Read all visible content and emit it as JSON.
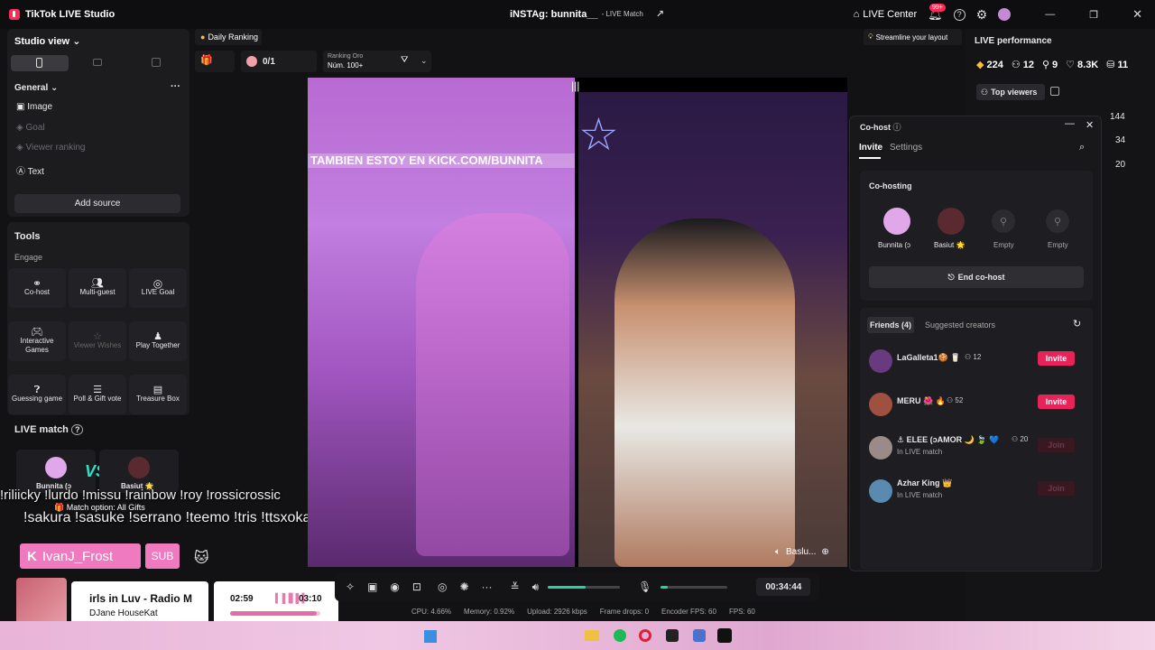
{
  "app": {
    "title": "TikTok LIVE Studio"
  },
  "window": {
    "center_title": "iNSTAg: bunnita__",
    "center_sub": "- LIVE Match",
    "live_center": "LIVE Center",
    "notif_badge": "99+"
  },
  "studio": {
    "view_label": "Studio view",
    "general": "General",
    "sources": [
      "Image",
      "Goal",
      "Viewer ranking",
      "Text"
    ],
    "add_source": "Add source"
  },
  "tools": {
    "heading": "Tools",
    "engage": "Engage",
    "items": [
      "Co-host",
      "Multi-guest",
      "LIVE Goal",
      "Interactive Games",
      "Viewer Wishes",
      "Play Together",
      "Guessing game",
      "Poll & Gift vote",
      "Treasure Box"
    ]
  },
  "live_match": {
    "heading": "LIVE match",
    "p1": "Bunnita (ↄ",
    "p2": "Basiut 🌟",
    "match_option": "Match option: All Gifts"
  },
  "overlay": {
    "line1": "!sakura !sasuke !serrano !teemo !tris !ttsxokas",
    "user": "IvanJ_Frost",
    "sub": "SUB",
    "song": "irls in Luv - Radio M",
    "artist": "DJane HouseKat",
    "t_start": "02:59",
    "t_end": "03:10"
  },
  "top_bar": {
    "daily_ranking": "Daily Ranking",
    "score": "0/1",
    "ranking_label": "Ranking Oro",
    "ranking_value": "Núm. 100+"
  },
  "stream": {
    "banner": "TAMBIEN ESTOY EN KICK.COM/BUNNITA",
    "guest_name": "Baslu..."
  },
  "hint": "Streamline your layout",
  "performance": {
    "heading": "LIVE performance",
    "stats": [
      "224",
      "12",
      "9",
      "8.3K",
      "11"
    ],
    "top_viewers": "Top viewers",
    "counts": [
      "144",
      "34",
      "20"
    ]
  },
  "cohost": {
    "title": "Co-host",
    "tab_invite": "Invite",
    "tab_settings": "Settings",
    "cohosting": "Co-hosting",
    "slots": [
      "Bunnita (ↄ",
      "Basiut 🌟",
      "Empty",
      "Empty"
    ],
    "end": "End co-host",
    "friends_tab": "Friends (4)",
    "suggested_tab": "Suggested creators",
    "friends": [
      {
        "name": "LaGalleta1🍪 🥛",
        "count": "12",
        "status": "",
        "action": "Invite"
      },
      {
        "name": "MERU 🌺 🔥",
        "count": "52",
        "status": "",
        "action": "Invite"
      },
      {
        "name": "⚓ ELEE (ↄAMOR 🌙 🍃 💙",
        "count": "20",
        "status": "In LIVE match",
        "action": "Join"
      },
      {
        "name": "Azhar King 👑",
        "count": "",
        "status": "In LIVE match",
        "action": "Join"
      }
    ]
  },
  "controls": {
    "timer": "00:34:44"
  },
  "stats_bar": {
    "cpu": "CPU: 4.66%",
    "memory": "Memory: 0.92%",
    "upload": "Upload: 2926 kbps",
    "drops": "Frame drops: 0",
    "encoder": "Encoder FPS: 60",
    "fps": "FPS: 60"
  },
  "colors": {
    "accent": "#fe2c55",
    "invite": "#e6245a",
    "green": "#20d5a0"
  }
}
